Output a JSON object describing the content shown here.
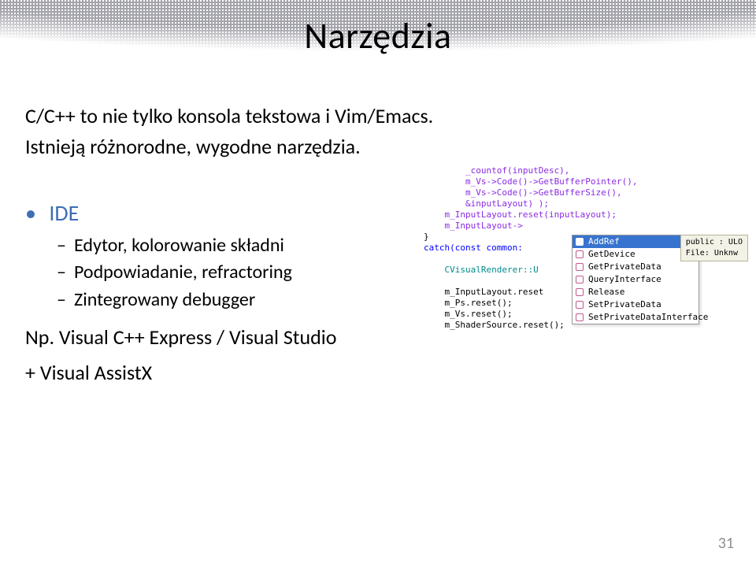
{
  "title": "Narzędzia",
  "intro": [
    "C/C++ to nie tylko konsola tekstowa i Vim/Emacs.",
    "Istnieją różnorodne, wygodne narzędzia."
  ],
  "bullet": {
    "label": "IDE",
    "subs": [
      "Edytor, kolorowanie składni",
      "Podpowiadanie, refractoring",
      "Zintegrowany debugger"
    ]
  },
  "after": [
    "Np. Visual C++ Express / Visual Studio",
    "+ Visual AssistX"
  ],
  "page_number": "31",
  "ide": {
    "code_top": "        _countof(inputDesc),\n        m_Vs->Code()->GetBufferPointer(),\n        m_Vs->Code()->GetBufferSize(),\n        &inputLayout) );\n    m_InputLayout.reset(inputLayout);\n    m_InputLayout->",
    "code_mid_open": "}",
    "code_mid_catch": "catch(const common:",
    "code_scope": "    CVisualRenderer::U",
    "code_bottom": "    m_InputLayout.reset\n    m_Ps.reset();\n    m_Vs.reset();\n    m_ShaderSource.reset();",
    "tooltip_line1": "public : ULO",
    "tooltip_line2": "File: Unknw",
    "popup": [
      {
        "label": "AddRef",
        "selected": true
      },
      {
        "label": "GetDevice",
        "selected": false
      },
      {
        "label": "GetPrivateData",
        "selected": false
      },
      {
        "label": "QueryInterface",
        "selected": false
      },
      {
        "label": "Release",
        "selected": false
      },
      {
        "label": "SetPrivateData",
        "selected": false
      },
      {
        "label": "SetPrivateDataInterface",
        "selected": false
      }
    ]
  }
}
